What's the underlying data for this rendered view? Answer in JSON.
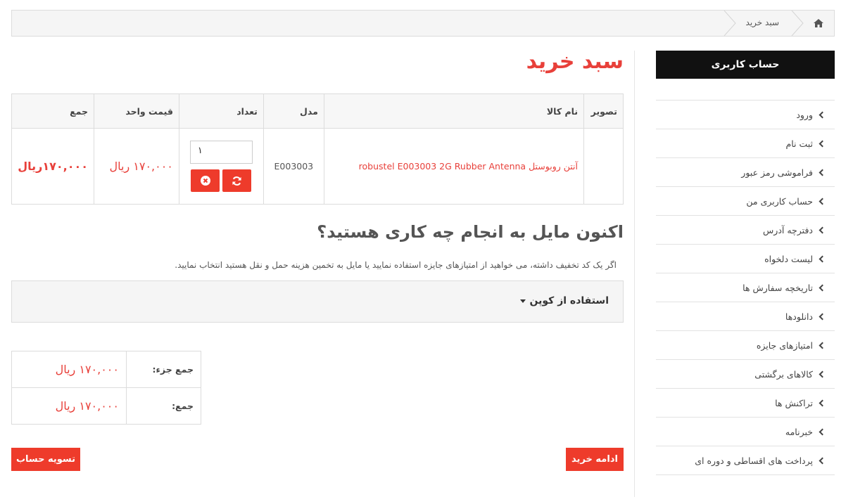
{
  "breadcrumb": {
    "current": "سبد خرید"
  },
  "page": {
    "title": "سبد خرید"
  },
  "cart": {
    "headers": {
      "image": "تصویر",
      "name": "نام کالا",
      "model": "مدل",
      "qty": "تعداد",
      "unit_price": "قیمت واحد",
      "total": "جمع"
    },
    "rows": [
      {
        "name": "آنتن روبوستل robustel E003003 2G Rubber Antenna",
        "model": "E003003",
        "qty": "۱",
        "unit_price": "۱۷۰,۰۰۰ ریال",
        "total": "۱۷۰,۰۰۰ریال"
      }
    ]
  },
  "next": {
    "title": "اکنون مایل به انجام چه کاری هستید؟",
    "desc": "اگر یک کد تخفیف داشته، می خواهید از امتیازهای جایزه استفاده نمایید یا مایل به تخمین هزینه حمل و نقل هستید انتخاب نمایید.",
    "coupon": "استفاده از کوپن"
  },
  "totals": [
    {
      "label": "جمع جزء:",
      "value": "۱۷۰,۰۰۰ ریال"
    },
    {
      "label": "جمع:",
      "value": "۱۷۰,۰۰۰ ریال"
    }
  ],
  "buttons": {
    "continue": "ادامه خرید",
    "checkout": "تسویه حساب"
  },
  "sidebar": {
    "title": "حساب کاربری",
    "items": [
      {
        "label": "ورود"
      },
      {
        "label": "ثبت نام"
      },
      {
        "label": "فراموشی رمز عبور"
      },
      {
        "label": "حساب کاربری من"
      },
      {
        "label": "دفترچه آدرس"
      },
      {
        "label": "لیست دلخواه"
      },
      {
        "label": "تاریخچه سفارش ها"
      },
      {
        "label": "دانلودها"
      },
      {
        "label": "امتیازهای جایزه"
      },
      {
        "label": "کالاهای برگشتی"
      },
      {
        "label": "تراکنش ها"
      },
      {
        "label": "خبرنامه"
      },
      {
        "label": "پرداخت های اقساطی و دوره ای"
      }
    ]
  },
  "colors": {
    "accent": "#ee3b2b",
    "sidebar_header": "#111111"
  },
  "icons": {
    "home": "home-icon",
    "remove": "remove-icon",
    "refresh": "refresh-icon",
    "chevron": "chevron-left-icon"
  }
}
